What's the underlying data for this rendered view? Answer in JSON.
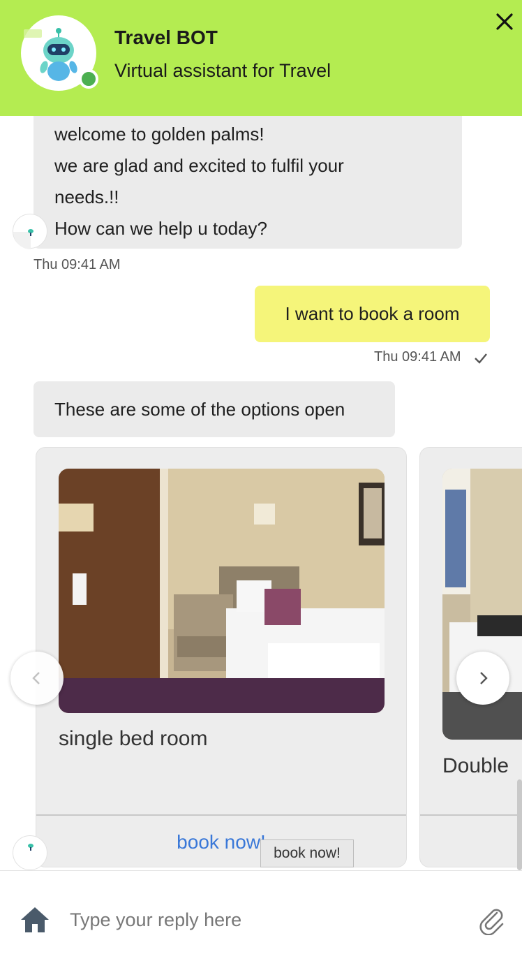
{
  "header": {
    "title": "Travel BOT",
    "subtitle": "Virtual assistant for Travel",
    "close_icon": "close-icon",
    "status": "online",
    "accent_color": "#b4ec51"
  },
  "messages": [
    {
      "sender": "bot",
      "lines": [
        "welcome to golden palms!",
        "we are glad and excited to fulfil your",
        "needs.!!",
        "How can we help u today?"
      ],
      "time": "Thu 09:41 AM"
    },
    {
      "sender": "user",
      "text": "I want to book a room",
      "time": "Thu 09:41 AM",
      "status_icon": "check-icon"
    },
    {
      "sender": "bot",
      "text": "These are some of the options open"
    }
  ],
  "carousel": {
    "cards": [
      {
        "title": "single bed room",
        "action": "book now!"
      },
      {
        "title": "Double"
      }
    ],
    "prev_icon": "chevron-left-icon",
    "next_icon": "chevron-right-icon",
    "tooltip": "book now!"
  },
  "footer": {
    "placeholder": "Type your reply here",
    "home_icon": "home-icon",
    "attach_icon": "paperclip-icon"
  },
  "colors": {
    "user_bubble": "#f5f57a",
    "bot_bubble": "#ebebeb",
    "link": "#3a78d8",
    "online": "#4caf50"
  }
}
